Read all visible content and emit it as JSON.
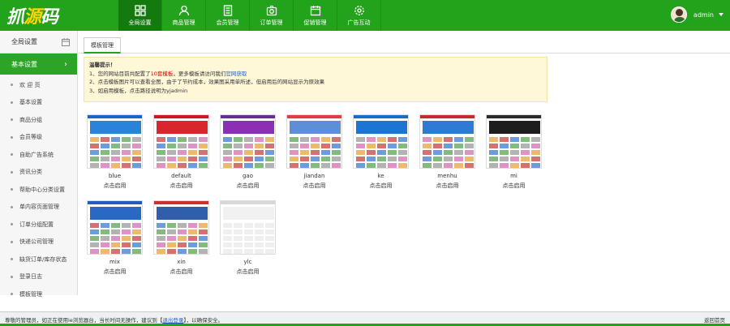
{
  "header": {
    "logo_part1": "抓",
    "logo_part2": "源",
    "logo_part3": "码",
    "nav": [
      {
        "label": "全局设置",
        "icon": "grid-icon"
      },
      {
        "label": "商品管理",
        "icon": "user-icon"
      },
      {
        "label": "会员管理",
        "icon": "document-icon"
      },
      {
        "label": "订单管理",
        "icon": "camera-icon"
      },
      {
        "label": "促销管理",
        "icon": "calendar-icon"
      },
      {
        "label": "广告互动",
        "icon": "gear-icon"
      }
    ],
    "username": "admin"
  },
  "sidebar": {
    "title": "全局设置",
    "section": "基本设置",
    "items": [
      {
        "label": "欢 迎 页"
      },
      {
        "label": "基本设置"
      },
      {
        "label": "商品分组"
      },
      {
        "label": "会员等级"
      },
      {
        "label": "自助广告系统"
      },
      {
        "label": "资讯分类"
      },
      {
        "label": "帮助中心分类设置"
      },
      {
        "label": "单内容页面管理"
      },
      {
        "label": "订单分组配置"
      },
      {
        "label": "快递公司管理"
      },
      {
        "label": "缺货订单/库存状态"
      },
      {
        "label": "登录日志"
      },
      {
        "label": "模板管理"
      }
    ]
  },
  "main": {
    "tab": "模板管理",
    "notice": {
      "title": "温馨提示！",
      "line1_a": "1、您的网站目前共配置了",
      "line1_b": "10套模板",
      "line1_c": "，更多模板请访问我们",
      "line1_link": "官网获取",
      "line2": "2、点击模板图片可以查看全图，由于了节约成本，效果图采用单所述，但启用后的网站显示为原效果",
      "line3": "3、如启用模板，点击路径说明为yjadmin"
    },
    "templates": [
      {
        "name": "blue",
        "action": "点击启用",
        "accent": "#1d63c5",
        "banner": "#2a83d8"
      },
      {
        "name": "default",
        "action": "点击启用",
        "accent": "#d4141a",
        "banner": "#d8262c"
      },
      {
        "name": "gao",
        "action": "点击启用",
        "accent": "#6b2c91",
        "banner": "#8b2fb5"
      },
      {
        "name": "jiandan",
        "action": "点击启用",
        "accent": "#e23d3d",
        "banner": "#5d8fd9"
      },
      {
        "name": "ke",
        "action": "点击启用",
        "accent": "#1a6cc4",
        "banner": "#1c74d3"
      },
      {
        "name": "menhu",
        "action": "点击启用",
        "accent": "#c72a2a",
        "banner": "#2f7bd3"
      },
      {
        "name": "mi",
        "action": "点击启用",
        "accent": "#2b2b2b",
        "banner": "#1d1d1d"
      },
      {
        "name": "mix",
        "action": "点击启用",
        "accent": "#1e5fb9",
        "banner": "#2b67c4"
      },
      {
        "name": "xin",
        "action": "点击启用",
        "accent": "#c93232",
        "banner": "#2f5fa8"
      },
      {
        "name": "ylc",
        "action": "点击启用",
        "accent": "#d8d8d8",
        "banner": "#f1f1f1"
      }
    ]
  },
  "status": {
    "left_a": "尊敬的管理员，如正在使用ie浏览器台，当长时间无操作，建议到",
    "left_link": "退出登录",
    "left_b": "，以确保安全。",
    "right": "返回首页"
  }
}
